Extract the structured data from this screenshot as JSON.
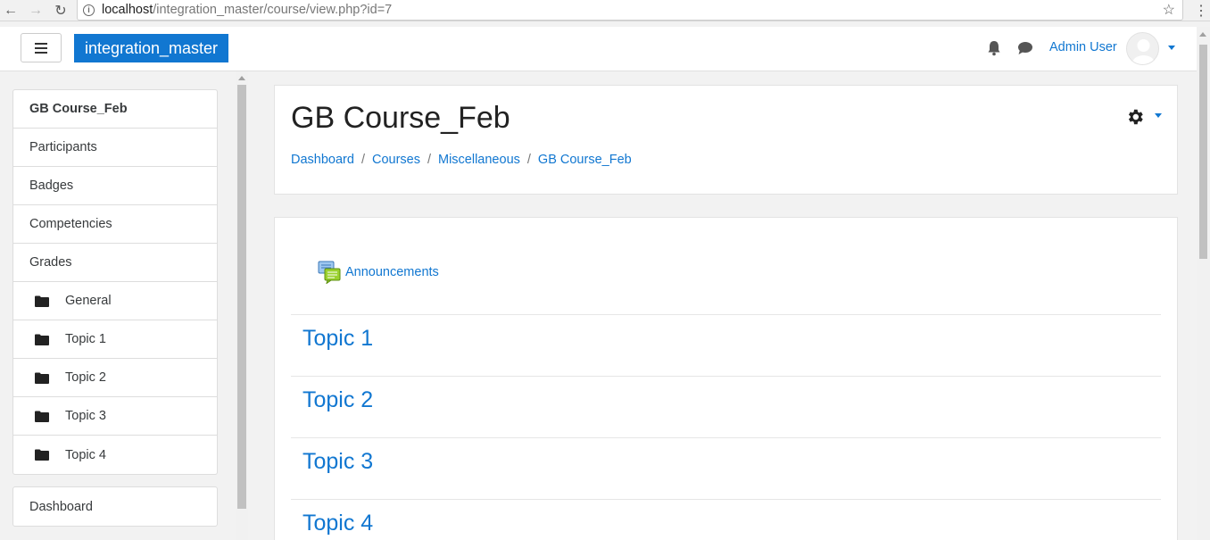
{
  "browser": {
    "url_host": "localhost",
    "url_path": "/integration_master/course/view.php?id=7"
  },
  "navbar": {
    "brand": "integration_master",
    "user_name": "Admin User",
    "icons": [
      "menu-icon",
      "bell-icon",
      "chat-icon",
      "avatar",
      "chevron-down-icon"
    ]
  },
  "drawer": {
    "items": [
      {
        "label": "GB Course_Feb",
        "active": true
      },
      {
        "label": "Participants"
      },
      {
        "label": "Badges"
      },
      {
        "label": "Competencies"
      },
      {
        "label": "Grades"
      },
      {
        "label": "General",
        "icon": "folder-icon"
      },
      {
        "label": "Topic 1",
        "icon": "folder-icon"
      },
      {
        "label": "Topic 2",
        "icon": "folder-icon"
      },
      {
        "label": "Topic 3",
        "icon": "folder-icon"
      },
      {
        "label": "Topic 4",
        "icon": "folder-icon"
      }
    ],
    "items2": [
      {
        "label": "Dashboard"
      }
    ]
  },
  "header": {
    "title": "GB Course_Feb",
    "breadcrumb": [
      "Dashboard",
      "Courses",
      "Miscellaneous",
      "GB Course_Feb"
    ]
  },
  "content": {
    "announcements": "Announcements",
    "sections": [
      "Topic 1",
      "Topic 2",
      "Topic 3",
      "Topic 4"
    ]
  },
  "colors": {
    "accent": "#1177d1",
    "background": "#f2f2f2"
  }
}
